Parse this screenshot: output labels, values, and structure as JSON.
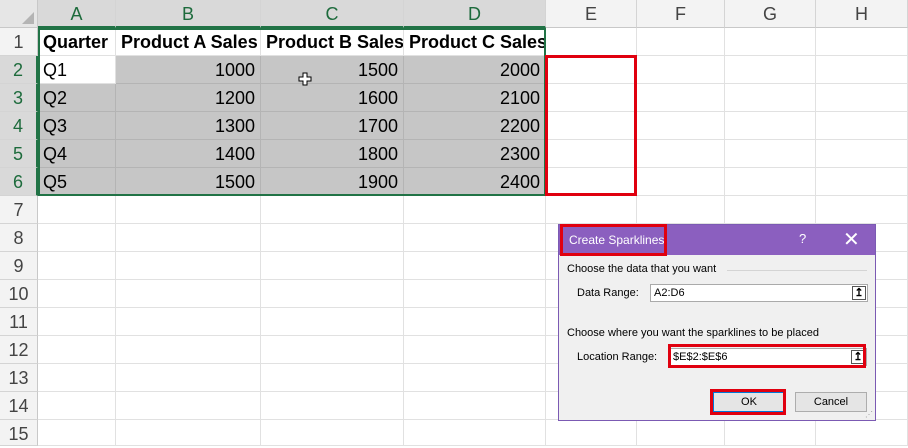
{
  "sheet": {
    "columns": [
      "A",
      "B",
      "C",
      "D",
      "E",
      "F",
      "G",
      "H"
    ],
    "rows": [
      "1",
      "2",
      "3",
      "4",
      "5",
      "6",
      "7",
      "8",
      "9",
      "10",
      "11",
      "12",
      "13",
      "14",
      "15",
      "16"
    ],
    "header_row": [
      "Quarter",
      "Product A Sales",
      "Product B Sales",
      "Product C Sales"
    ],
    "data": [
      [
        "Q1",
        "1000",
        "1500",
        "2000"
      ],
      [
        "Q2",
        "1200",
        "1600",
        "2100"
      ],
      [
        "Q3",
        "1300",
        "1700",
        "2200"
      ],
      [
        "Q4",
        "1400",
        "1800",
        "2300"
      ],
      [
        "Q5",
        "1500",
        "1900",
        "2400"
      ]
    ]
  },
  "dialog": {
    "title": "Create Sparklines",
    "help": "?",
    "close": "✕",
    "group1": "Choose the data that you want",
    "data_range_label": "Data Range:",
    "data_range_value": "A2:D6",
    "group2": "Choose where you want the sparklines to be placed",
    "location_range_label": "Location Range:",
    "location_range_value": "$E$2:$E$6",
    "ok_label": "OK",
    "cancel_label": "Cancel",
    "collapse_icon": "↥"
  },
  "colors": {
    "excel_green": "#217346",
    "highlight_red": "#e0000f",
    "dialog_purple": "#8b5fbf",
    "selection_gray": "#c6c6c6"
  }
}
